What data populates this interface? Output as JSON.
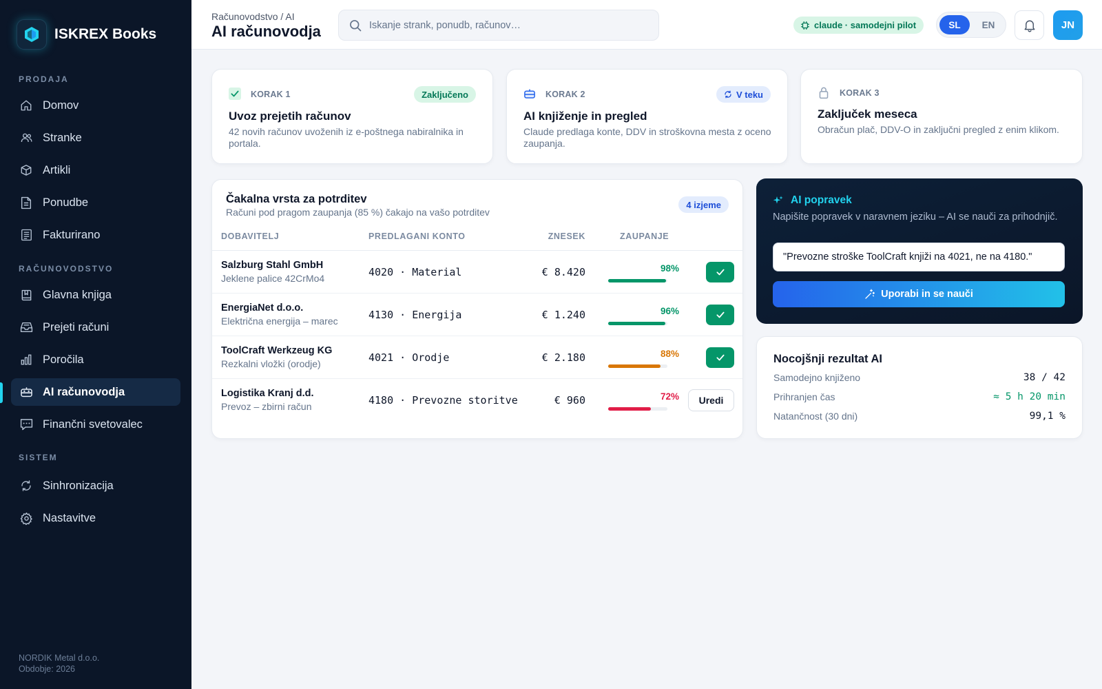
{
  "brand": {
    "name": "ISKREX Books"
  },
  "sidebar": {
    "sections": [
      {
        "label": "PRODAJA"
      },
      {
        "label": "RAČUNOVODSTVO"
      },
      {
        "label": "SISTEM"
      }
    ],
    "items": [
      {
        "label": "Domov",
        "icon": "home-icon"
      },
      {
        "label": "Stranke",
        "icon": "users-icon"
      },
      {
        "label": "Artikli",
        "icon": "box-icon"
      },
      {
        "label": "Ponudbe",
        "icon": "document-icon"
      },
      {
        "label": "Fakturirano",
        "icon": "receipt-icon"
      },
      {
        "label": "Glavna knjiga",
        "icon": "book-icon"
      },
      {
        "label": "Prejeti računi",
        "icon": "inbox-icon"
      },
      {
        "label": "Poročila",
        "icon": "bar-chart-icon"
      },
      {
        "label": "AI računovodja",
        "icon": "robot-icon",
        "active": true
      },
      {
        "label": "Finančni svetovalec",
        "icon": "chat-icon"
      },
      {
        "label": "Sinhronizacija",
        "icon": "sync-icon"
      },
      {
        "label": "Nastavitve",
        "icon": "gear-icon"
      }
    ],
    "footer": {
      "company": "NORDIK Metal d.o.o.",
      "period": "Obdobje: 2026"
    }
  },
  "header": {
    "breadcrumb": "Računovodstvo / AI",
    "title": "AI računovodja",
    "search_placeholder": "Iskanje strank, ponudb, računov…",
    "pilot_badge": "claude · samodejni pilot",
    "lang_sl": "SL",
    "lang_en": "EN",
    "lang_active": "SL",
    "avatar_initials": "JN"
  },
  "steps": [
    {
      "label": "KORAK 1",
      "badge": "Zaključeno",
      "title": "Uvoz prejetih računov",
      "desc": "42 novih računov uvoženih iz e-poštnega nabiralnika in portala."
    },
    {
      "label": "KORAK 2",
      "badge": "V teku",
      "title": "AI knjiženje in pregled",
      "desc": "Claude predlaga konte, DDV in stroškovna mesta z oceno zaupanja."
    },
    {
      "label": "KORAK 3",
      "badge": "",
      "title": "Zaključek meseca",
      "desc": "Obračun plač, DDV-O in zaključni pregled z enim klikom."
    }
  ],
  "queue": {
    "title": "Čakalna vrsta za potrditev",
    "subtitle": "Računi pod pragom zaupanja (85 %) čakajo na vašo potrditev",
    "count": "4 izjeme",
    "columns": [
      "DOBAVITELJ",
      "PREDLAGANI KONTO",
      "ZNESEK",
      "ZAUPANJE"
    ],
    "rows": [
      {
        "supplier": "Salzburg Stahl GmbH",
        "desc": "Jeklene palice 42CrMo4",
        "account": "4020 · Material",
        "amount": "€ 8.420",
        "confidence": 98,
        "confidence_label": "98%",
        "color": "#059669",
        "action": "confirm"
      },
      {
        "supplier": "EnergiaNet d.o.o.",
        "desc": "Električna energija – marec",
        "account": "4130 · Energija",
        "amount": "€ 1.240",
        "confidence": 96,
        "confidence_label": "96%",
        "color": "#059669",
        "action": "confirm"
      },
      {
        "supplier": "ToolCraft Werkzeug KG",
        "desc": "Rezkalni vložki (orodje)",
        "account": "4021 · Orodje",
        "amount": "€ 2.180",
        "confidence": 88,
        "confidence_label": "88%",
        "color": "#d97706",
        "action": "confirm"
      },
      {
        "supplier": "Logistika Kranj d.d.",
        "desc": "Prevoz – zbirni račun",
        "account": "4180 · Prevozne storitve",
        "amount": "€ 960",
        "confidence": 72,
        "confidence_label": "72%",
        "color": "#e11d48",
        "action": "edit",
        "action_label": "Uredi"
      }
    ]
  },
  "ai_correction": {
    "title": "AI popravek",
    "desc": "Napišite popravek v naravnem jeziku – AI se nauči za prihodnjič.",
    "input_value": "\"Prevozne stroške ToolCraft knjiži na 4021, ne na 4180.\"",
    "button": "Uporabi in se nauči"
  },
  "result": {
    "title": "Nocojšnji rezultat AI",
    "rows": [
      {
        "label": "Samodejno knjiženo",
        "value": "38 / 42"
      },
      {
        "label": "Prihranjen čas",
        "value": "≈ 5 h 20 min"
      },
      {
        "label": "Natančnost (30 dni)",
        "value": "99,1 %"
      }
    ]
  },
  "colors": {
    "accent": "#2563eb",
    "cyan": "#22d3ee",
    "success": "#059669",
    "warning": "#d97706",
    "danger": "#e11d48",
    "sidebar": "#0b1628"
  }
}
